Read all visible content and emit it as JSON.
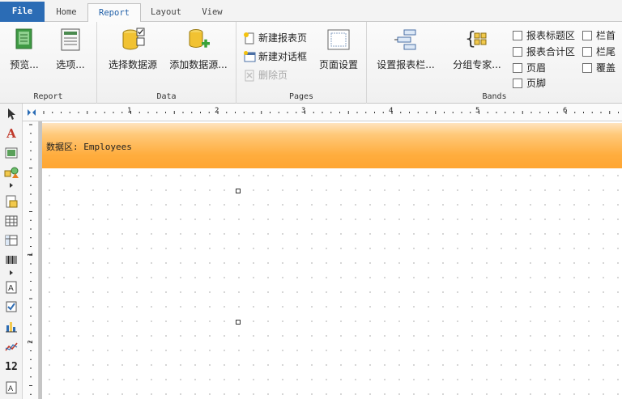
{
  "tabs": [
    {
      "label": "File"
    },
    {
      "label": "Home"
    },
    {
      "label": "Report"
    },
    {
      "label": "Layout"
    },
    {
      "label": "View"
    }
  ],
  "active_tab": "Report",
  "ribbon": {
    "report": {
      "label": "Report",
      "preview": "预览...",
      "options": "选项..."
    },
    "data": {
      "label": "Data",
      "select_source": "选择数据源",
      "add_source": "添加数据源..."
    },
    "pages": {
      "label": "Pages",
      "new_page": "新建报表页",
      "new_dialog": "新建对话框",
      "delete_page": "删除页",
      "page_setup": "页面设置"
    },
    "bands": {
      "label": "Bands",
      "configure": "设置报表栏...",
      "group_expert": "分组专家...",
      "report_title": "报表标题区",
      "report_summary": "报表合计区",
      "page_header": "页眉",
      "page_footer": "页脚",
      "column_header": "栏首",
      "column_footer": "栏尾",
      "overlay": "覆盖"
    }
  },
  "ruler": {
    "h_numbers": [
      "1",
      "2",
      "3",
      "4",
      "5",
      "6"
    ],
    "v_numbers": [
      "1",
      "2"
    ]
  },
  "canvas": {
    "band_title": "数据区: Employees"
  },
  "colors": {
    "file_tab": "#2b6cb5",
    "band_orange": "#ffad3e"
  }
}
